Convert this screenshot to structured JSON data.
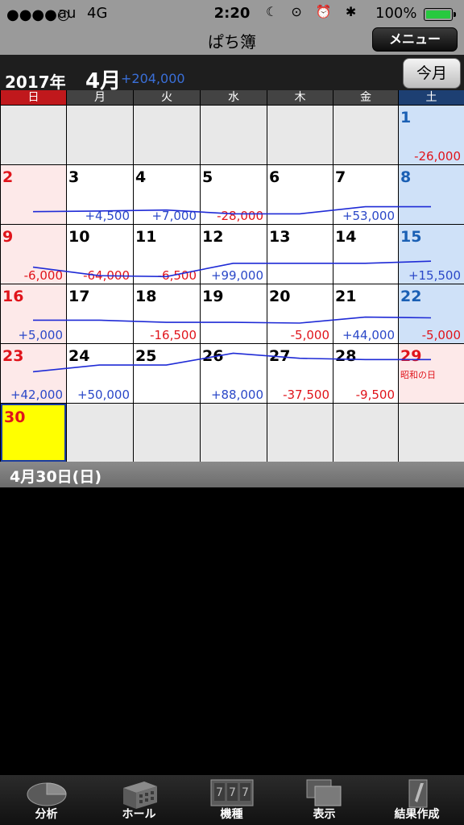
{
  "status": {
    "signal": "●●●●○",
    "carrier": "au",
    "network": "4G",
    "time": "2:20",
    "icons": "☾ ⊙ ⏰ ✱",
    "battery": "100%"
  },
  "nav": {
    "title": "ぱち簿",
    "menu_label": "メニュー"
  },
  "month_header": {
    "year": "2017年",
    "month": "4月",
    "total": "+204,000",
    "today_label": "今月"
  },
  "weekdays": [
    "日",
    "月",
    "火",
    "水",
    "木",
    "金",
    "土"
  ],
  "weeks": [
    [
      {
        "day": "",
        "amt": ""
      },
      {
        "day": "",
        "amt": ""
      },
      {
        "day": "",
        "amt": ""
      },
      {
        "day": "",
        "amt": ""
      },
      {
        "day": "",
        "amt": ""
      },
      {
        "day": "",
        "amt": ""
      },
      {
        "day": "1",
        "amt": "-26,000"
      }
    ],
    [
      {
        "day": "2",
        "amt": ""
      },
      {
        "day": "3",
        "amt": "+4,500"
      },
      {
        "day": "4",
        "amt": "+7,000"
      },
      {
        "day": "5",
        "amt": "-28,000"
      },
      {
        "day": "6",
        "amt": ""
      },
      {
        "day": "7",
        "amt": "+53,000"
      },
      {
        "day": "8",
        "amt": ""
      }
    ],
    [
      {
        "day": "9",
        "amt": "-6,000"
      },
      {
        "day": "10",
        "amt": "-64,000"
      },
      {
        "day": "11",
        "amt": "-6,500"
      },
      {
        "day": "12",
        "amt": "+99,000"
      },
      {
        "day": "13",
        "amt": ""
      },
      {
        "day": "14",
        "amt": ""
      },
      {
        "day": "15",
        "amt": "+15,500"
      }
    ],
    [
      {
        "day": "16",
        "amt": "+5,000"
      },
      {
        "day": "17",
        "amt": ""
      },
      {
        "day": "18",
        "amt": "-16,500"
      },
      {
        "day": "19",
        "amt": ""
      },
      {
        "day": "20",
        "amt": "-5,000"
      },
      {
        "day": "21",
        "amt": "+44,000"
      },
      {
        "day": "22",
        "amt": "-5,000"
      }
    ],
    [
      {
        "day": "23",
        "amt": "+42,000"
      },
      {
        "day": "24",
        "amt": "+50,000"
      },
      {
        "day": "25",
        "amt": ""
      },
      {
        "day": "26",
        "amt": "+88,000"
      },
      {
        "day": "27",
        "amt": "-37,500"
      },
      {
        "day": "28",
        "amt": "-9,500"
      },
      {
        "day": "29",
        "amt": "",
        "holiday": "昭和の日"
      }
    ],
    [
      {
        "day": "30",
        "amt": "",
        "selected": true
      },
      {
        "day": "",
        "amt": ""
      },
      {
        "day": "",
        "amt": ""
      },
      {
        "day": "",
        "amt": ""
      },
      {
        "day": "",
        "amt": ""
      },
      {
        "day": "",
        "amt": ""
      },
      {
        "day": "",
        "amt": ""
      }
    ]
  ],
  "selected_date": "4月30日(日)",
  "chart_data": {
    "type": "line",
    "days": [
      1,
      2,
      3,
      4,
      5,
      6,
      7,
      8,
      9,
      10,
      11,
      12,
      13,
      14,
      15,
      16,
      17,
      18,
      19,
      20,
      21,
      22,
      23,
      24,
      25,
      26,
      27,
      28,
      29,
      30
    ],
    "cumulative": [
      -26000,
      -26000,
      -21500,
      -14500,
      -42500,
      -42500,
      10500,
      10500,
      4500,
      -59500,
      -66000,
      33000,
      33000,
      33000,
      48500,
      53500,
      53500,
      37000,
      37000,
      32000,
      76000,
      71000,
      113000,
      163000,
      163000,
      251000,
      213500,
      204000,
      204000,
      204000
    ],
    "color": "#1f2bd6"
  },
  "tabs": [
    {
      "label": "分析",
      "icon": "pie-chart-icon"
    },
    {
      "label": "ホール",
      "icon": "building-icon"
    },
    {
      "label": "機種",
      "icon": "slot-machine-icon"
    },
    {
      "label": "表示",
      "icon": "windows-icon"
    },
    {
      "label": "結果作成",
      "icon": "pencil-icon"
    }
  ],
  "colors": {
    "sunday": "#c0181c",
    "saturday": "#1d3f72",
    "plus": "#2b48c8",
    "minus": "#e0141b",
    "selected": "#ffff00"
  }
}
